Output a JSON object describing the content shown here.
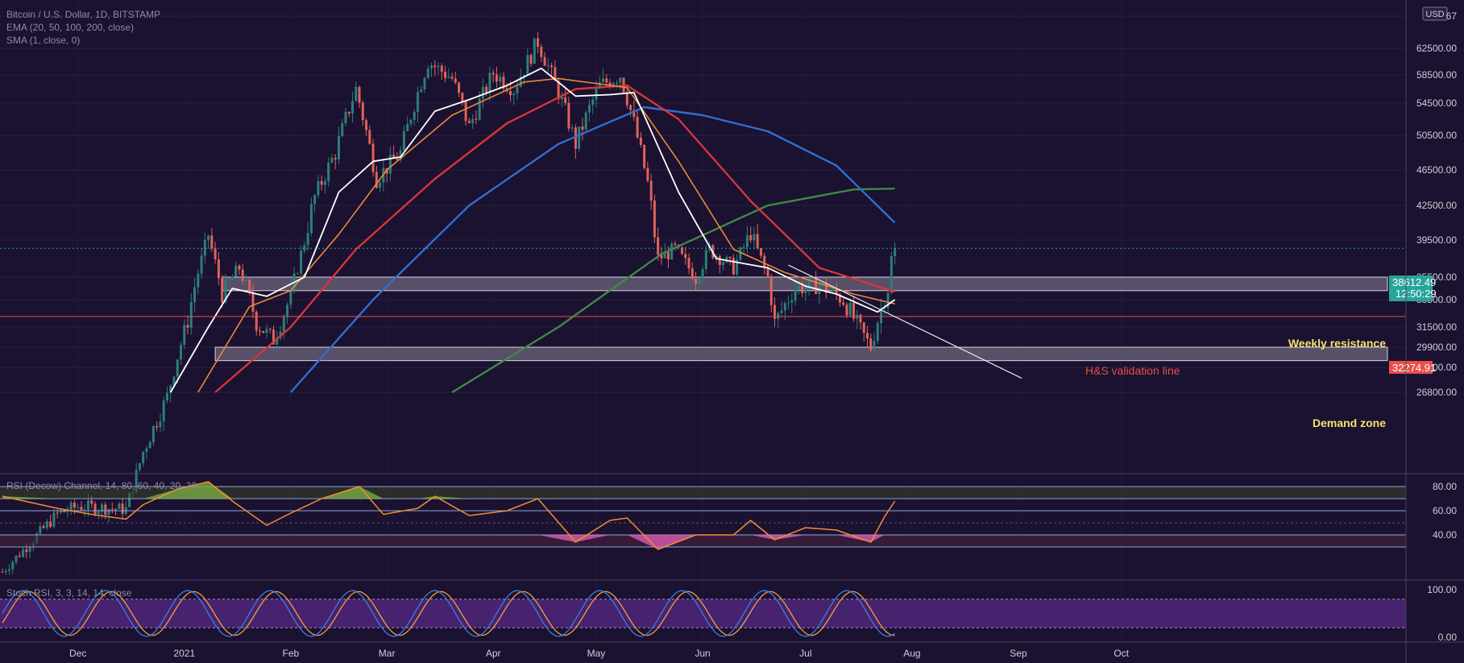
{
  "header": {
    "title": "Bitcoin / U.S. Dollar, 1D, BITSTAMP",
    "indicator_1": "EMA (20, 50, 100, 200, close)",
    "indicator_2": "SMA (1, close, 0)"
  },
  "currency_button": "USD",
  "price_tags": {
    "last_price": "38612.49",
    "countdown": "12:50:29",
    "hs_level": "32274.91"
  },
  "annotations": {
    "weekly_resistance": "Weekly resistance",
    "hs_validation": "H&S validation line",
    "demand_zone": "Demand zone"
  },
  "rsi_panel": {
    "legend": "RSI (Decow) Channel, 14, 80, 60, 40, 20, 30"
  },
  "stoch_panel": {
    "legend": "Stoch RSI, 3, 3, 14, 14, close"
  },
  "colors": {
    "background": "#1b1130",
    "candle_up": "#2b7f7a",
    "candle_down": "#e0625b",
    "ema20": "#ffffff",
    "ema50": "#e98a3a",
    "ema100": "#d4363a",
    "ema200_blue": "#2f6fcf",
    "ema200_green": "#3f8a46",
    "zone_fill": "#8a8498",
    "hs_line": "#e8504a",
    "last_price_tag": "#26a69a",
    "rsi_line": "#f09030",
    "rsi_bull_fill": "#7cb342",
    "rsi_bear_fill": "#e860b8",
    "stoch_k": "#3a7fe0",
    "stoch_d": "#f0a040",
    "stoch_band": "#5a2a8a"
  },
  "chart_data": [
    {
      "type": "candlestick",
      "title": "Bitcoin / U.S. Dollar, 1D, BITSTAMP",
      "x_ticks": [
        "Dec",
        "2021",
        "Feb",
        "Mar",
        "Apr",
        "May",
        "Jun",
        "Jul",
        "Aug",
        "Sep",
        "Oct"
      ],
      "y_ticks": [
        67000,
        62500,
        58500,
        54500,
        50500,
        46500,
        42500,
        39500,
        35500,
        33500,
        31500,
        29900,
        28400,
        26800
      ],
      "y_tick_labels": [
        "67",
        "62500.00",
        "58500.00",
        "54500.00",
        "50500.00",
        "46500.00",
        "42500.00",
        "39500.00",
        "35500.00",
        "33500.00",
        "31500.00",
        "29900.00",
        "28400.00",
        "26800.00"
      ],
      "last_price": 38612.49,
      "price_path": [
        [
          "2020-11-09",
          15300
        ],
        [
          "2020-11-25",
          19000
        ],
        [
          "2020-12-01",
          19500
        ],
        [
          "2020-12-15",
          19300
        ],
        [
          "2020-12-20",
          23000
        ],
        [
          "2020-12-27",
          26500
        ],
        [
          "2021-01-02",
          32000
        ],
        [
          "2021-01-08",
          40000
        ],
        [
          "2021-01-12",
          34000
        ],
        [
          "2021-01-17",
          36500
        ],
        [
          "2021-01-22",
          31800
        ],
        [
          "2021-01-27",
          30500
        ],
        [
          "2021-02-01",
          33800
        ],
        [
          "2021-02-08",
          43500
        ],
        [
          "2021-02-14",
          48500
        ],
        [
          "2021-02-20",
          56500
        ],
        [
          "2021-02-26",
          45500
        ],
        [
          "2021-03-05",
          48500
        ],
        [
          "2021-03-13",
          60500
        ],
        [
          "2021-03-20",
          58000
        ],
        [
          "2021-03-25",
          51500
        ],
        [
          "2021-04-01",
          58800
        ],
        [
          "2021-04-07",
          56500
        ],
        [
          "2021-04-14",
          63500
        ],
        [
          "2021-04-20",
          56000
        ],
        [
          "2021-04-25",
          49500
        ],
        [
          "2021-05-02",
          57000
        ],
        [
          "2021-05-08",
          58500
        ],
        [
          "2021-05-12",
          52000
        ],
        [
          "2021-05-16",
          45000
        ],
        [
          "2021-05-19",
          37500
        ],
        [
          "2021-05-24",
          38500
        ],
        [
          "2021-05-30",
          35500
        ],
        [
          "2021-06-03",
          38500
        ],
        [
          "2021-06-10",
          36500
        ],
        [
          "2021-06-15",
          40200
        ],
        [
          "2021-06-20",
          35500
        ],
        [
          "2021-06-22",
          31800
        ],
        [
          "2021-06-28",
          34500
        ],
        [
          "2021-07-05",
          34800
        ],
        [
          "2021-07-12",
          33500
        ],
        [
          "2021-07-20",
          29900
        ],
        [
          "2021-07-22",
          32000
        ],
        [
          "2021-07-25",
          34500
        ],
        [
          "2021-07-26",
          37500
        ],
        [
          "2021-07-27",
          38612
        ]
      ],
      "ema20": [
        [
          "2020-12-28",
          26800
        ],
        [
          "2021-01-08",
          31500
        ],
        [
          "2021-01-15",
          34500
        ],
        [
          "2021-01-25",
          33800
        ],
        [
          "2021-02-05",
          35500
        ],
        [
          "2021-02-15",
          44000
        ],
        [
          "2021-02-25",
          47500
        ],
        [
          "2021-03-05",
          48000
        ],
        [
          "2021-03-15",
          53500
        ],
        [
          "2021-03-25",
          55000
        ],
        [
          "2021-04-05",
          57000
        ],
        [
          "2021-04-15",
          59500
        ],
        [
          "2021-04-25",
          55500
        ],
        [
          "2021-05-05",
          55700
        ],
        [
          "2021-05-12",
          56000
        ],
        [
          "2021-05-25",
          44000
        ],
        [
          "2021-06-05",
          37500
        ],
        [
          "2021-06-20",
          36500
        ],
        [
          "2021-07-01",
          34700
        ],
        [
          "2021-07-10",
          34000
        ],
        [
          "2021-07-22",
          32600
        ],
        [
          "2021-07-27",
          33500
        ]
      ],
      "ema50": [
        [
          "2021-01-05",
          26800
        ],
        [
          "2021-01-20",
          33000
        ],
        [
          "2021-02-01",
          34300
        ],
        [
          "2021-02-15",
          40000
        ],
        [
          "2021-03-01",
          46500
        ],
        [
          "2021-03-20",
          53000
        ],
        [
          "2021-04-10",
          57500
        ],
        [
          "2021-04-20",
          58000
        ],
        [
          "2021-05-10",
          56700
        ],
        [
          "2021-05-25",
          47500
        ],
        [
          "2021-06-10",
          38500
        ],
        [
          "2021-06-25",
          36000
        ],
        [
          "2021-07-15",
          34000
        ],
        [
          "2021-07-27",
          33200
        ]
      ],
      "ema100": [
        [
          "2021-01-10",
          26800
        ],
        [
          "2021-02-01",
          31500
        ],
        [
          "2021-02-20",
          38500
        ],
        [
          "2021-03-15",
          45500
        ],
        [
          "2021-04-05",
          52000
        ],
        [
          "2021-04-25",
          56500
        ],
        [
          "2021-05-10",
          57000
        ],
        [
          "2021-05-25",
          52500
        ],
        [
          "2021-06-15",
          43000
        ],
        [
          "2021-07-05",
          36500
        ],
        [
          "2021-07-27",
          34200
        ]
      ],
      "ema200_blue": [
        [
          "2021-02-01",
          26800
        ],
        [
          "2021-02-25",
          33500
        ],
        [
          "2021-03-25",
          42500
        ],
        [
          "2021-04-20",
          49500
        ],
        [
          "2021-05-15",
          54000
        ],
        [
          "2021-06-01",
          53000
        ],
        [
          "2021-06-20",
          51000
        ],
        [
          "2021-07-10",
          47000
        ],
        [
          "2021-07-27",
          41000
        ]
      ],
      "ema200_green": [
        [
          "2021-03-20",
          26800
        ],
        [
          "2021-04-20",
          31500
        ],
        [
          "2021-05-20",
          38000
        ],
        [
          "2021-06-20",
          42500
        ],
        [
          "2021-07-15",
          44300
        ],
        [
          "2021-07-27",
          44400
        ]
      ],
      "zones": [
        {
          "label": "Weekly resistance",
          "from": 34300,
          "to": 35500
        },
        {
          "label": "Demand zone",
          "from": 28900,
          "to": 29900
        }
      ],
      "horizontal_line": {
        "label": "H&S validation line",
        "value": 32274.91
      }
    },
    {
      "type": "line",
      "title": "RSI",
      "y_ticks": [
        80,
        60,
        40
      ],
      "y_tick_labels": [
        "80.00",
        "60.00",
        "40.00"
      ],
      "bands": [
        80,
        70,
        60,
        50,
        40,
        30
      ],
      "values": [
        [
          "2020-11-09",
          72
        ],
        [
          "2020-11-25",
          62
        ],
        [
          "2020-12-05",
          57
        ],
        [
          "2020-12-15",
          53
        ],
        [
          "2020-12-20",
          65
        ],
        [
          "2020-12-30",
          78
        ],
        [
          "2021-01-08",
          84
        ],
        [
          "2021-01-15",
          68
        ],
        [
          "2021-01-25",
          48
        ],
        [
          "2021-02-01",
          58
        ],
        [
          "2021-02-10",
          70
        ],
        [
          "2021-02-21",
          80
        ],
        [
          "2021-02-28",
          57
        ],
        [
          "2021-03-10",
          62
        ],
        [
          "2021-03-15",
          72
        ],
        [
          "2021-03-25",
          56
        ],
        [
          "2021-04-05",
          60
        ],
        [
          "2021-04-14",
          70
        ],
        [
          "2021-04-25",
          34
        ],
        [
          "2021-05-05",
          52
        ],
        [
          "2021-05-10",
          54
        ],
        [
          "2021-05-19",
          28
        ],
        [
          "2021-05-30",
          40
        ],
        [
          "2021-06-10",
          40
        ],
        [
          "2021-06-15",
          52
        ],
        [
          "2021-06-22",
          36
        ],
        [
          "2021-07-01",
          46
        ],
        [
          "2021-07-10",
          44
        ],
        [
          "2021-07-20",
          34
        ],
        [
          "2021-07-24",
          55
        ],
        [
          "2021-07-27",
          68
        ]
      ]
    },
    {
      "type": "line",
      "title": "Stoch RSI",
      "y_ticks": [
        100,
        0
      ],
      "y_tick_labels": [
        "100.00",
        "0.00"
      ],
      "band": [
        80,
        20
      ],
      "cycle_days": 24
    }
  ]
}
